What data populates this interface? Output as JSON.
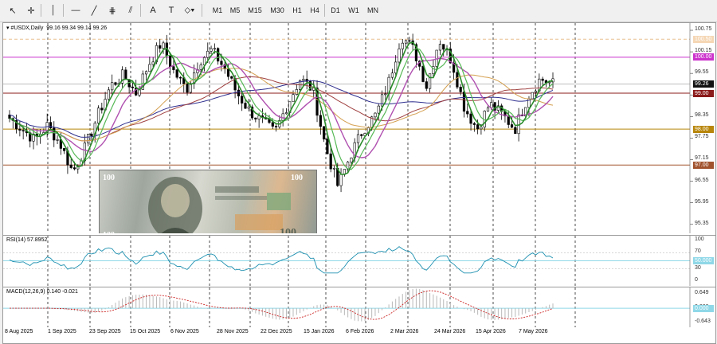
{
  "toolbar": {
    "tools": [
      {
        "name": "cursor-icon",
        "glyph": "↖"
      },
      {
        "name": "crosshair-icon",
        "glyph": "✛"
      },
      {
        "name": "vertical-line-icon",
        "glyph": "│"
      },
      {
        "name": "horizontal-line-icon",
        "glyph": "—"
      },
      {
        "name": "trendline-icon",
        "glyph": "╱"
      },
      {
        "name": "fibonacci-icon",
        "glyph": "⋕"
      },
      {
        "name": "channel-icon",
        "glyph": "⫽"
      },
      {
        "name": "text-icon",
        "glyph": "A"
      },
      {
        "name": "text-label-icon",
        "glyph": "T"
      },
      {
        "name": "shapes-icon",
        "glyph": "⬦▾"
      }
    ],
    "timeframes": [
      "M1",
      "M5",
      "M15",
      "M30",
      "H1",
      "H4",
      "D1",
      "W1",
      "MN"
    ]
  },
  "header": {
    "symbol": "#USDX,Daily",
    "ohlc": "99.16 99.34 99.14 99.26"
  },
  "price_axis": {
    "ticks": [
      "100.75",
      "100.15",
      "99.55",
      "98.95",
      "98.35",
      "97.75",
      "97.15",
      "96.55",
      "95.95",
      "95.35"
    ]
  },
  "price_tags": [
    {
      "value": "100.50",
      "bg": "#f5d7b5",
      "color": "#fff",
      "line": "#e8c090"
    },
    {
      "value": "100.00",
      "bg": "#cc33cc",
      "color": "#fff",
      "line": "#cc33cc"
    },
    {
      "value": "99.26",
      "bg": "#111111",
      "color": "#fff",
      "line": "#999999"
    },
    {
      "value": "99.00",
      "bg": "#8b1a1a",
      "color": "#fff",
      "line": "#8b1a1a"
    },
    {
      "value": "98.00",
      "bg": "#b8860b",
      "color": "#fff",
      "line": "#b8860b"
    },
    {
      "value": "97.00",
      "bg": "#a0522d",
      "color": "#fff",
      "line": "#a0522d"
    }
  ],
  "rsi": {
    "label": "RSI(14) 57.8952",
    "ticks": [
      "100",
      "70",
      "30",
      "0"
    ],
    "level_tag": "50.000",
    "color": "#1e90b0"
  },
  "macd": {
    "label": "MACD(12,26,9) 0.140 -0.021",
    "ticks": [
      "0.649",
      "0.000",
      "-0.643"
    ],
    "zero_tag": "0.000",
    "hist_color": "#b8b8b8",
    "signal_color": "#cc2222"
  },
  "dates": [
    "8 Aug 2025",
    "1 Sep 2025",
    "23 Sep 2025",
    "15 Oct 2025",
    "6 Nov 2025",
    "28 Nov 2025",
    "22 Dec 2025",
    "15 Jan 2026",
    "6 Feb 2026",
    "2 Mar 2026",
    "24 Mar 2026",
    "15 Apr 2026",
    "7 May 2026"
  ],
  "colors": {
    "bull": "#000000",
    "ma_fast": "#2a8c2a",
    "ma_fast2": "#55b855",
    "ma_mid": "#b050b0",
    "ma_slow": "#d4a050",
    "ma_slow2": "#a04040",
    "ma_long": "#303090"
  },
  "chart_data": {
    "type": "line",
    "title": "#USDX,Daily",
    "ylim": [
      95.1,
      100.95
    ],
    "x_dates": [
      "8 Aug 2025",
      "1 Sep 2025",
      "23 Sep 2025",
      "15 Oct 2025",
      "6 Nov 2025",
      "28 Nov 2025",
      "22 Dec 2025",
      "15 Jan 2026",
      "6 Feb 2026",
      "2 Mar 2026",
      "24 Mar 2026",
      "15 Apr 2026",
      "7 May 2026"
    ],
    "close_series": [
      98.3,
      98.0,
      97.7,
      98.1,
      97.6,
      96.8,
      97.5,
      98.4,
      99.2,
      99.5,
      99.0,
      99.8,
      100.4,
      99.6,
      99.1,
      99.9,
      100.2,
      99.7,
      99.0,
      98.5,
      98.2,
      97.9,
      98.7,
      99.4,
      99.1,
      97.5,
      96.4,
      97.3,
      98.0,
      98.4,
      99.3,
      100.6,
      100.2,
      99.2,
      100.5,
      99.9,
      98.6,
      98.0,
      98.7,
      98.4,
      98.0,
      98.9,
      99.4,
      99.26
    ],
    "ma_levels": [
      {
        "name": "",
        "last": 99.05
      },
      {
        "name": "",
        "last": 98.6
      },
      {
        "name": "",
        "last": 98.58
      }
    ],
    "horizontal_levels": [
      100.5,
      100.0,
      99.0,
      98.0,
      97.0
    ]
  }
}
